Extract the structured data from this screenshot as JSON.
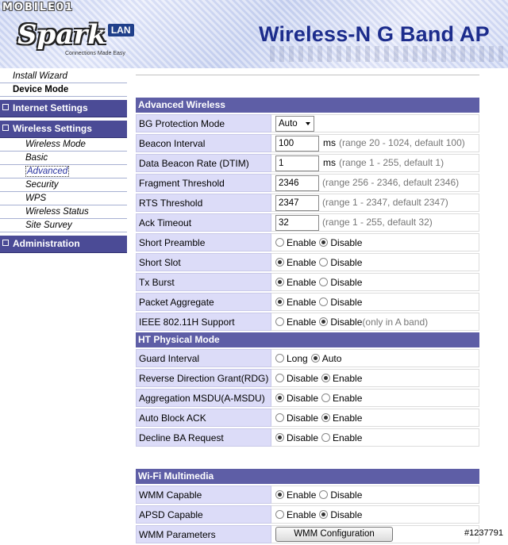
{
  "header": {
    "watermark": "MOBILE01",
    "logo_name": "Spark",
    "logo_badge": "LAN",
    "logo_tagline": "Connections Made Easy",
    "product_title": "Wireless-N G Band AP"
  },
  "sidebar": {
    "install_wizard": "Install Wizard",
    "device_mode": "Device Mode",
    "internet_settings": "Internet Settings",
    "wireless_settings": "Wireless Settings",
    "wireless_items": [
      "Wireless Mode",
      "Basic",
      "Advanced",
      "Security",
      "WPS",
      "Wireless Status",
      "Site Survey"
    ],
    "administration": "Administration"
  },
  "advanced": {
    "title": "Advanced Wireless",
    "bg_protection": {
      "label": "BG Protection Mode",
      "value": "Auto"
    },
    "beacon_interval": {
      "label": "Beacon Interval",
      "value": "100",
      "unit": "ms",
      "hint": "(range 20 - 1024, default 100)"
    },
    "dtim": {
      "label": "Data Beacon Rate (DTIM)",
      "value": "1",
      "unit": "ms",
      "hint": "(range 1 - 255, default 1)"
    },
    "fragment": {
      "label": "Fragment Threshold",
      "value": "2346",
      "hint": "(range 256 - 2346, default 2346)"
    },
    "rts": {
      "label": "RTS Threshold",
      "value": "2347",
      "hint": "(range 1 - 2347, default 2347)"
    },
    "ack_timeout": {
      "label": "Ack Timeout",
      "value": "32",
      "hint": "(range 1 - 255, default 32)"
    },
    "short_preamble": {
      "label": "Short Preamble",
      "opt1": "Enable",
      "opt2": "Disable",
      "selected": "Disable"
    },
    "short_slot": {
      "label": "Short Slot",
      "opt1": "Enable",
      "opt2": "Disable",
      "selected": "Enable"
    },
    "tx_burst": {
      "label": "Tx Burst",
      "opt1": "Enable",
      "opt2": "Disable",
      "selected": "Enable"
    },
    "packet_aggregate": {
      "label": "Packet Aggregate",
      "opt1": "Enable",
      "opt2": "Disable",
      "selected": "Enable"
    },
    "ieee80211h": {
      "label": "IEEE 802.11H Support",
      "opt1": "Enable",
      "opt2": "Disable",
      "selected": "Disable",
      "note": "(only in A band)"
    }
  },
  "ht": {
    "title": "HT Physical Mode",
    "guard_interval": {
      "label": "Guard Interval",
      "opt1": "Long",
      "opt2": "Auto",
      "selected": "Auto"
    },
    "rdg": {
      "label": "Reverse Direction Grant(RDG)",
      "opt1": "Disable",
      "opt2": "Enable",
      "selected": "Enable"
    },
    "amsdu": {
      "label": "Aggregation MSDU(A-MSDU)",
      "opt1": "Disable",
      "opt2": "Enable",
      "selected": "Disable"
    },
    "auto_ba": {
      "label": "Auto Block ACK",
      "opt1": "Disable",
      "opt2": "Enable",
      "selected": "Enable"
    },
    "decline_ba": {
      "label": "Decline BA Request",
      "opt1": "Disable",
      "opt2": "Enable",
      "selected": "Disable"
    }
  },
  "wmm": {
    "title": "Wi-Fi Multimedia",
    "capable": {
      "label": "WMM Capable",
      "opt1": "Enable",
      "opt2": "Disable",
      "selected": "Enable"
    },
    "apsd": {
      "label": "APSD Capable",
      "opt1": "Enable",
      "opt2": "Disable",
      "selected": "Disable"
    },
    "parameters": {
      "label": "WMM Parameters",
      "button": "WMM Configuration"
    }
  },
  "corner_tag": "#1237791",
  "colors": {
    "section": "#5e5ea6",
    "label_bg": "#dcdcf8",
    "sidebar_head": "#4b4b96",
    "title": "#1c2c8c"
  }
}
